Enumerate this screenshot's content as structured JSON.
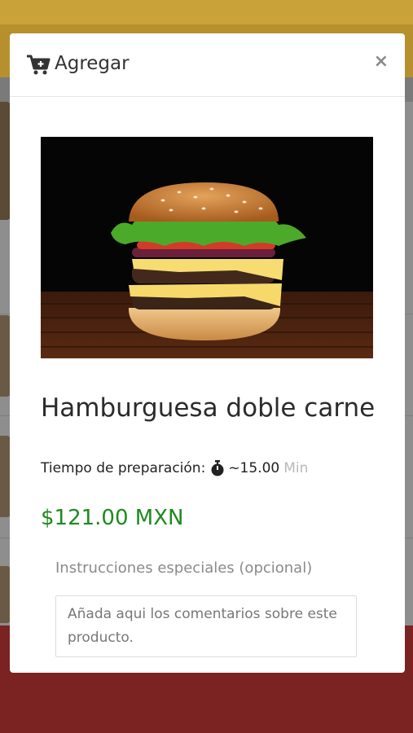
{
  "modal": {
    "title": "Agregar",
    "close_symbol": "×",
    "product": {
      "name": "Hamburguesa doble carne",
      "image_alt": "hamburger-photo",
      "prep_label": "Tiempo de preparación:",
      "prep_value": "~15.00",
      "prep_unit": "Min",
      "price": "$121.00 MXN"
    },
    "instructions": {
      "label": "Instrucciones especiales (opcional)",
      "placeholder": "Añada aqui los comentarios sobre este producto."
    }
  },
  "icons": {
    "cart": "cart-plus-icon",
    "timer": "stopwatch-icon",
    "close": "close-icon"
  },
  "colors": {
    "price": "#1e8a1e",
    "top_bar": "#caa23a",
    "bottom_bar": "#7b2222"
  }
}
